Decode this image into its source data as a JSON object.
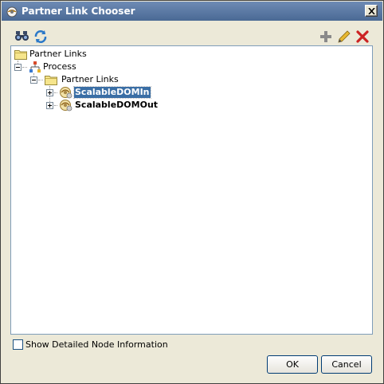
{
  "window": {
    "title": "Partner Link Chooser",
    "close_symbol": "×"
  },
  "toolbar": {
    "left_icons": [
      "binoculars-icon",
      "refresh-icon"
    ],
    "right_icons": [
      "plus-icon",
      "pencil-icon",
      "delete-icon"
    ]
  },
  "tree": {
    "root": {
      "label": "Partner Links",
      "icon": "folder-icon"
    },
    "process": {
      "label": "Process",
      "icon": "process-icon",
      "expanded": true
    },
    "partner_links": {
      "label": "Partner Links",
      "icon": "folder-icon",
      "expanded": true
    },
    "items": [
      {
        "label": "ScalableDOMIn",
        "icon": "partner-link-icon",
        "selected": true,
        "expanded": false
      },
      {
        "label": "ScalableDOMOut",
        "icon": "partner-link-icon",
        "selected": false,
        "expanded": false
      }
    ]
  },
  "options": {
    "show_details_label": "Show Detailed Node Information",
    "show_details_checked": false
  },
  "buttons": {
    "ok": "OK",
    "cancel": "Cancel"
  },
  "colors": {
    "title_bar": "#4a6994",
    "selection": "#3a6ea5",
    "delete_red": "#cc2222"
  }
}
